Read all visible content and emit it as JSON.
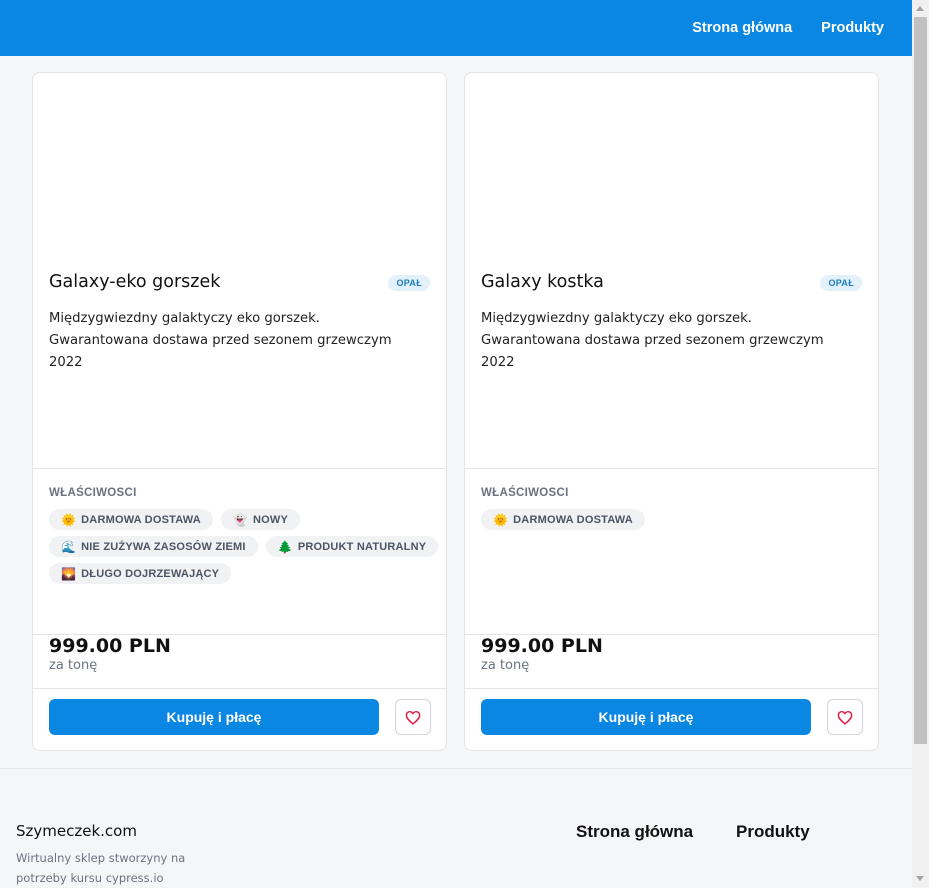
{
  "nav": {
    "home": "Strona główna",
    "products": "Produkty"
  },
  "features_label": "WŁAŚCIWOSCI",
  "products": [
    {
      "title": "Galaxy-eko gorszek",
      "badge": "OPAŁ",
      "description": "Międzygwiezdny galaktyczy eko gorszek. Gwarantowana dostawa przed sezonem grzewczym 2022",
      "features": [
        {
          "icon": "sun-icon",
          "glyph": "🌞",
          "label": "DARMOWA DOSTAWA"
        },
        {
          "icon": "ghost-icon",
          "glyph": "👻",
          "label": "NOWY"
        },
        {
          "icon": "wave-icon",
          "glyph": "🌊",
          "label": "NIE ZUŻYWA ZASOSÓW ZIEMI"
        },
        {
          "icon": "tree-icon",
          "glyph": "🌲",
          "label": "PRODUKT NATURALNY"
        },
        {
          "icon": "sunrise-icon",
          "glyph": "🌄",
          "label": "DŁUGO DOJRZEWAJĄCY"
        }
      ],
      "price": "999.00 PLN",
      "unit": "za tonę",
      "buy_label": "Kupuję i płacę"
    },
    {
      "title": "Galaxy kostka",
      "badge": "OPAŁ",
      "description": "Międzygwiezdny galaktyczy eko gorszek. Gwarantowana dostawa przed sezonem grzewczym 2022",
      "features": [
        {
          "icon": "sun-icon",
          "glyph": "🌞",
          "label": "DARMOWA DOSTAWA"
        }
      ],
      "price": "999.00 PLN",
      "unit": "za tonę",
      "buy_label": "Kupuję i płacę"
    }
  ],
  "footer": {
    "brand": "Szymeczek.com",
    "description": "Wirtualny sklep stworzyny na potrzeby kursu cypress.io",
    "link_home": "Strona główna",
    "link_products": "Produkty"
  },
  "colors": {
    "primary": "#0a87e3",
    "badge_bg": "#e3f1fb",
    "heart": "#e11d48"
  }
}
